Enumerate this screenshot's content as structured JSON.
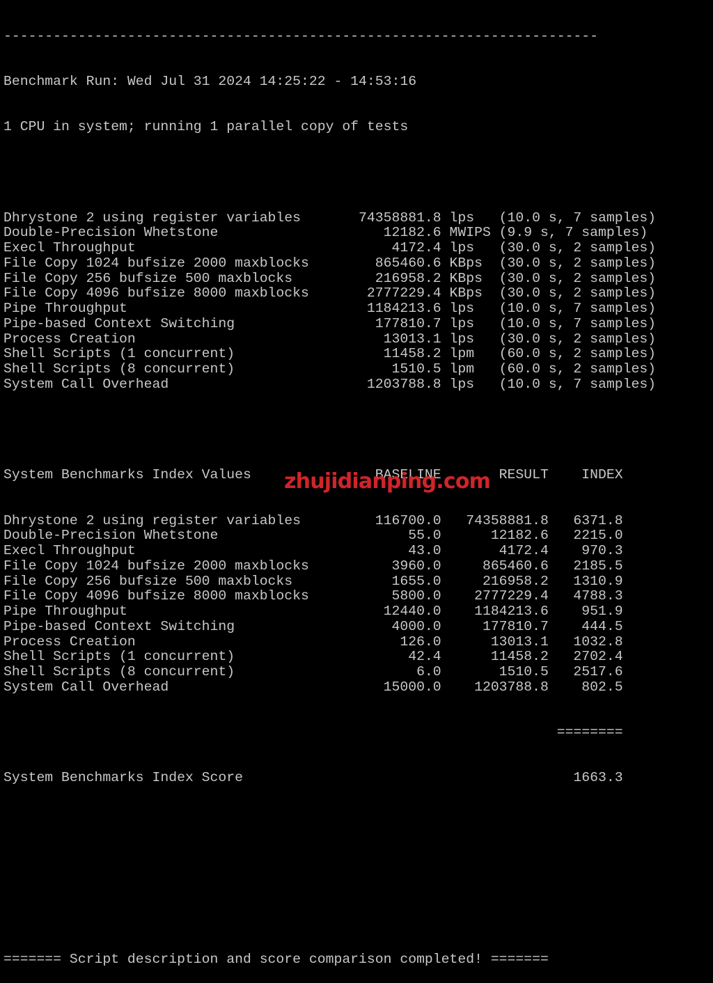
{
  "terminal": {
    "separator_char": "-",
    "separator_length": 72,
    "run_header": "Benchmark Run: Wed Jul 31 2024 14:25:22 - 14:53:16",
    "cpu_info": "1 CPU in system; running 1 parallel copy of tests",
    "raw_results": [
      {
        "name": "Dhrystone 2 using register variables",
        "value": "74358881.8",
        "unit": "lps",
        "time": "10.0",
        "samples": 7
      },
      {
        "name": "Double-Precision Whetstone",
        "value": "12182.6",
        "unit": "MWIPS",
        "time": "9.9",
        "samples": 7
      },
      {
        "name": "Execl Throughput",
        "value": "4172.4",
        "unit": "lps",
        "time": "30.0",
        "samples": 2
      },
      {
        "name": "File Copy 1024 bufsize 2000 maxblocks",
        "value": "865460.6",
        "unit": "KBps",
        "time": "30.0",
        "samples": 2
      },
      {
        "name": "File Copy 256 bufsize 500 maxblocks",
        "value": "216958.2",
        "unit": "KBps",
        "time": "30.0",
        "samples": 2
      },
      {
        "name": "File Copy 4096 bufsize 8000 maxblocks",
        "value": "2777229.4",
        "unit": "KBps",
        "time": "30.0",
        "samples": 2
      },
      {
        "name": "Pipe Throughput",
        "value": "1184213.6",
        "unit": "lps",
        "time": "10.0",
        "samples": 7
      },
      {
        "name": "Pipe-based Context Switching",
        "value": "177810.7",
        "unit": "lps",
        "time": "10.0",
        "samples": 7
      },
      {
        "name": "Process Creation",
        "value": "13013.1",
        "unit": "lps",
        "time": "30.0",
        "samples": 2
      },
      {
        "name": "Shell Scripts (1 concurrent)",
        "value": "11458.2",
        "unit": "lpm",
        "time": "60.0",
        "samples": 2
      },
      {
        "name": "Shell Scripts (8 concurrent)",
        "value": "1510.5",
        "unit": "lpm",
        "time": "60.0",
        "samples": 2
      },
      {
        "name": "System Call Overhead",
        "value": "1203788.8",
        "unit": "lps",
        "time": "10.0",
        "samples": 7
      }
    ],
    "index_table": {
      "title": "System Benchmarks Index Values",
      "columns": [
        "BASELINE",
        "RESULT",
        "INDEX"
      ],
      "rows": [
        {
          "name": "Dhrystone 2 using register variables",
          "baseline": "116700.0",
          "result": "74358881.8",
          "index": "6371.8"
        },
        {
          "name": "Double-Precision Whetstone",
          "baseline": "55.0",
          "result": "12182.6",
          "index": "2215.0"
        },
        {
          "name": "Execl Throughput",
          "baseline": "43.0",
          "result": "4172.4",
          "index": "970.3"
        },
        {
          "name": "File Copy 1024 bufsize 2000 maxblocks",
          "baseline": "3960.0",
          "result": "865460.6",
          "index": "2185.5"
        },
        {
          "name": "File Copy 256 bufsize 500 maxblocks",
          "baseline": "1655.0",
          "result": "216958.2",
          "index": "1310.9"
        },
        {
          "name": "File Copy 4096 bufsize 8000 maxblocks",
          "baseline": "5800.0",
          "result": "2777229.4",
          "index": "4788.3"
        },
        {
          "name": "Pipe Throughput",
          "baseline": "12440.0",
          "result": "1184213.6",
          "index": "951.9"
        },
        {
          "name": "Pipe-based Context Switching",
          "baseline": "4000.0",
          "result": "177810.7",
          "index": "444.5"
        },
        {
          "name": "Process Creation",
          "baseline": "126.0",
          "result": "13013.1",
          "index": "1032.8"
        },
        {
          "name": "Shell Scripts (1 concurrent)",
          "baseline": "42.4",
          "result": "11458.2",
          "index": "2702.4"
        },
        {
          "name": "Shell Scripts (8 concurrent)",
          "baseline": "6.0",
          "result": "1510.5",
          "index": "2517.6"
        },
        {
          "name": "System Call Overhead",
          "baseline": "15000.0",
          "result": "1203788.8",
          "index": "802.5"
        }
      ],
      "total_rule": "========",
      "score_label": "System Benchmarks Index Score",
      "score_value": "1663.3"
    },
    "completion_message": "======= Script description and score comparison completed! ======="
  },
  "watermark": {
    "text": "zhujidianping.com",
    "color": "#d0242b"
  },
  "colors": {
    "background": "#000000",
    "text": "#c8c8c8"
  }
}
